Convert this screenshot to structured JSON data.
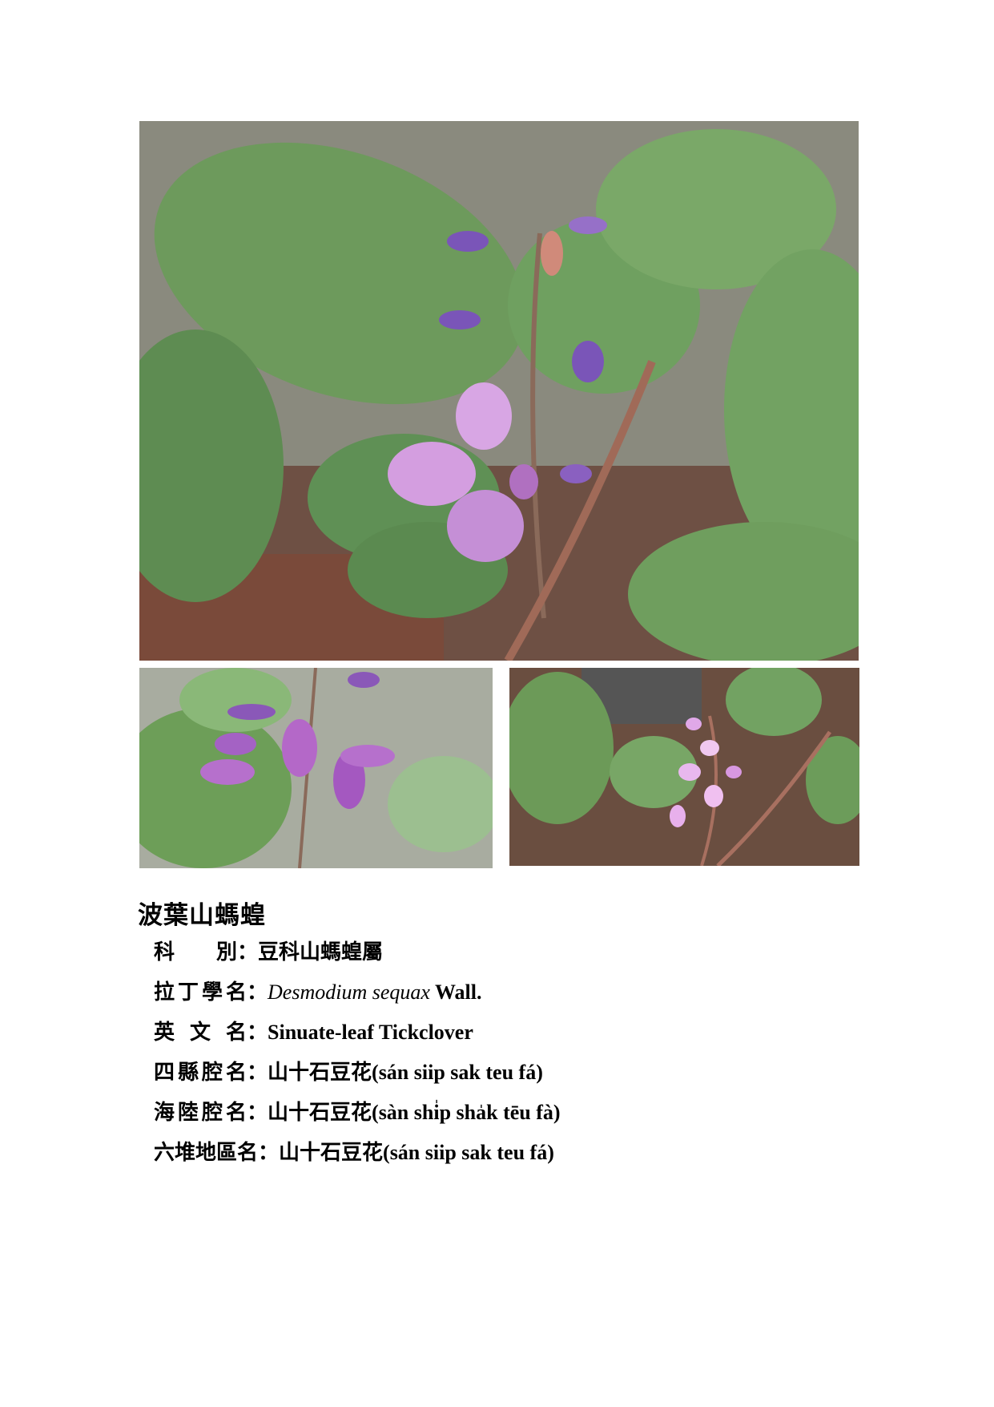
{
  "plant": {
    "name": "波葉山螞蝗",
    "rows": [
      {
        "label": "科　　別",
        "value": "豆科山螞蝗屬"
      },
      {
        "label": "拉丁學名",
        "value_italic": "Desmodium sequax",
        "value": " Wall."
      },
      {
        "label": "英 文 名",
        "value": "Sinuate-leaf Tickclover"
      },
      {
        "label": "四縣腔名",
        "value_zh": "山十石豆花",
        "value": "(sán siip sak teu fá)"
      },
      {
        "label": "海陸腔名",
        "value_zh": "山十石豆花",
        "value": "(sàn shi̍p sha̍k tēu fà)"
      },
      {
        "label": "六堆地區名",
        "value_zh": "山十石豆花",
        "value": "(sán siip sak teu fá)"
      }
    ],
    "colon": "："
  },
  "colors": {
    "leaf": "#6d9a5c",
    "leaf_light": "#8cb478",
    "flower": "#c58fd6",
    "flower_dark": "#7a55b8",
    "soil": "#6b4a3c"
  }
}
